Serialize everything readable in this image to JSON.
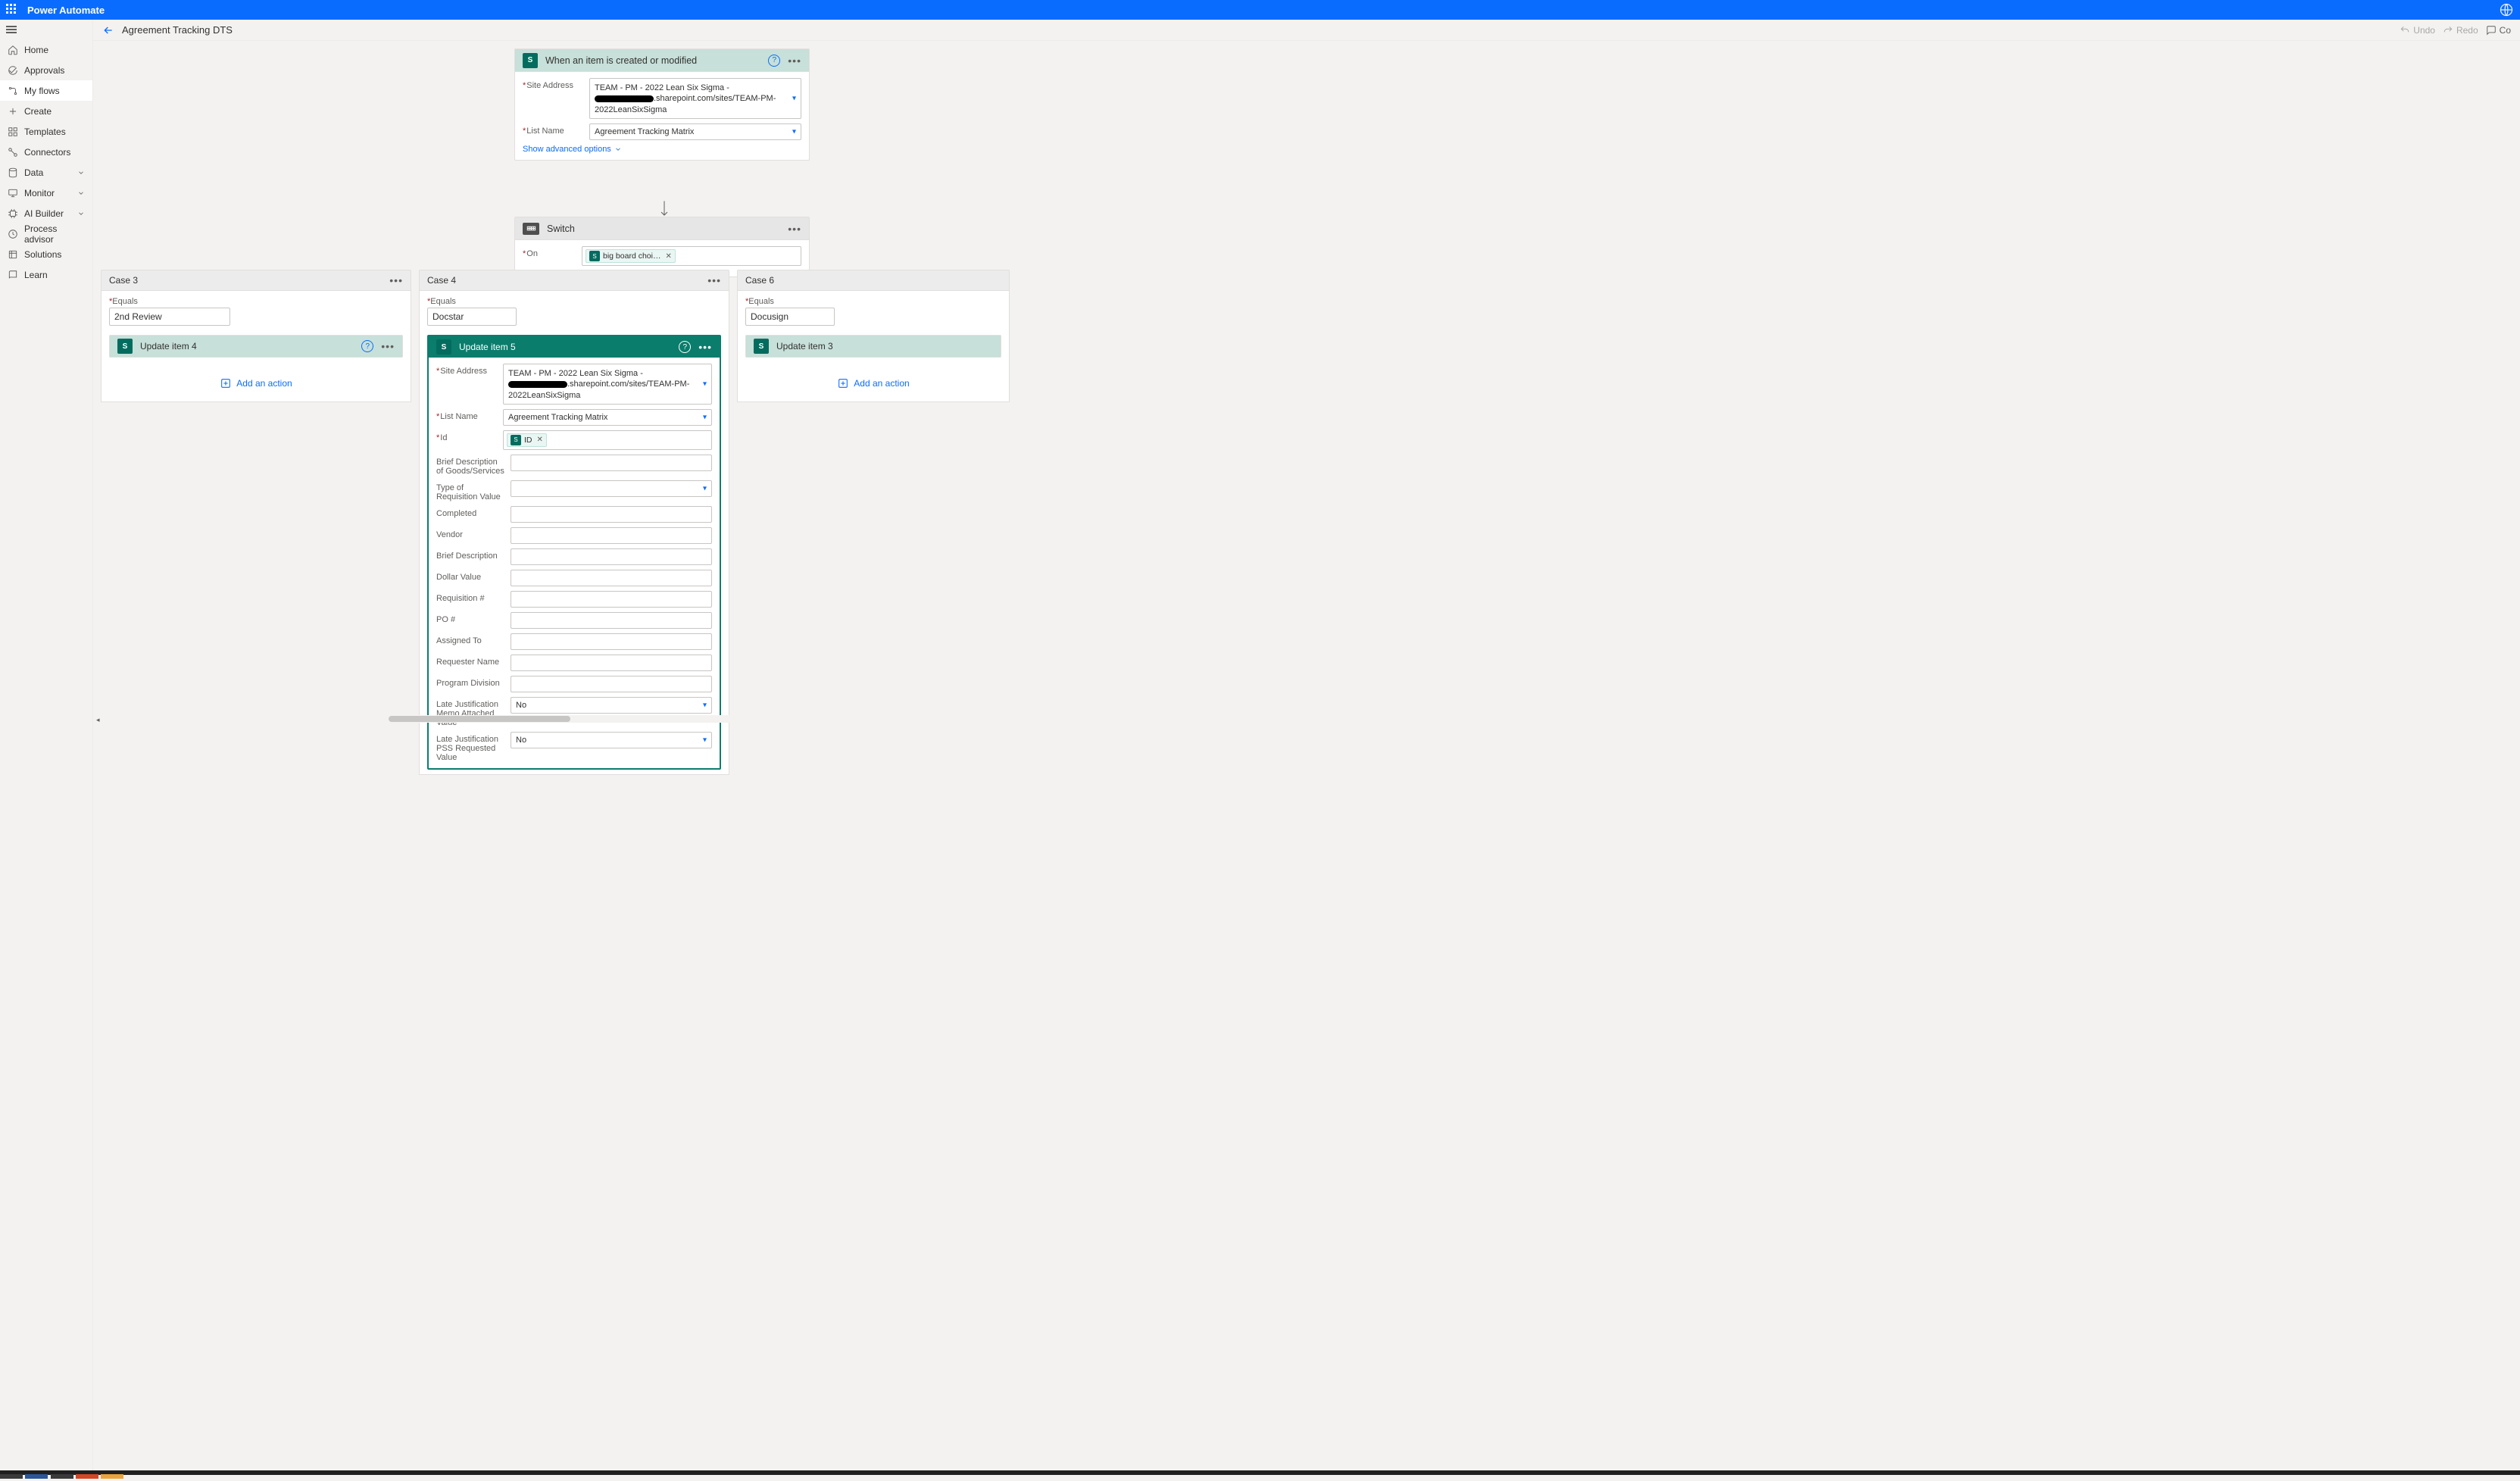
{
  "product_name": "Power Automate",
  "sidebar": {
    "items": [
      {
        "label": "Home",
        "icon": "home"
      },
      {
        "label": "Approvals",
        "icon": "approvals"
      },
      {
        "label": "My flows",
        "icon": "myflows",
        "active": true
      },
      {
        "label": "Create",
        "icon": "create"
      },
      {
        "label": "Templates",
        "icon": "templates"
      },
      {
        "label": "Connectors",
        "icon": "connectors"
      },
      {
        "label": "Data",
        "icon": "data",
        "caret": true
      },
      {
        "label": "Monitor",
        "icon": "monitor",
        "caret": true
      },
      {
        "label": "AI Builder",
        "icon": "ai",
        "caret": true
      },
      {
        "label": "Process advisor",
        "icon": "process"
      },
      {
        "label": "Solutions",
        "icon": "solutions"
      },
      {
        "label": "Learn",
        "icon": "learn"
      }
    ]
  },
  "cmdbar": {
    "flow_title": "Agreement Tracking DTS",
    "undo": "Undo",
    "redo": "Redo",
    "comment": "Co"
  },
  "trigger": {
    "title": "When an item is created or modified",
    "site_label": "Site Address",
    "site_value_line1": "TEAM - PM - 2022 Lean Six Sigma -",
    "site_value_line2": ".sharepoint.com/sites/TEAM-PM-",
    "site_value_line3": "2022LeanSixSigma",
    "list_label": "List Name",
    "list_value": "Agreement Tracking Matrix",
    "advanced": "Show advanced options"
  },
  "switch": {
    "title": "Switch",
    "on_label": "On",
    "on_pill": "big board choi…"
  },
  "cases": {
    "c2": {
      "action_title": ""
    },
    "c3": {
      "label": "Case 3",
      "equals_label": "Equals",
      "equals_value": "2nd Review",
      "action_title": "Update item 4",
      "add": "Add an action"
    },
    "c4": {
      "label": "Case 4",
      "equals_label": "Equals",
      "equals_value": "Docstar",
      "action_title": "Update item 5",
      "site_label": "Site Address",
      "site_value_line1": "TEAM - PM - 2022 Lean Six Sigma -",
      "site_value_line2": ".sharepoint.com/sites/TEAM-PM-",
      "site_value_line3": "2022LeanSixSigma",
      "list_label": "List Name",
      "list_value": "Agreement Tracking Matrix",
      "id_label": "Id",
      "id_pill": "ID",
      "fields": [
        "Brief Description of Goods/Services",
        "Type of Requisition Value",
        "Completed",
        "Vendor",
        "Brief Description",
        "Dollar Value",
        "Requisition #",
        "PO #",
        "Assigned To",
        "Requester Name",
        "Program Division"
      ],
      "sel_fields": [
        {
          "label": "Late Justification Memo Attached Value",
          "value": "No"
        },
        {
          "label": "Late Justification PSS Requested Value",
          "value": "No"
        }
      ]
    },
    "c6": {
      "label": "Case 6",
      "equals_label": "Equals",
      "equals_value": "Docusign",
      "action_title": "Update item 3",
      "add": "Add an action"
    }
  }
}
